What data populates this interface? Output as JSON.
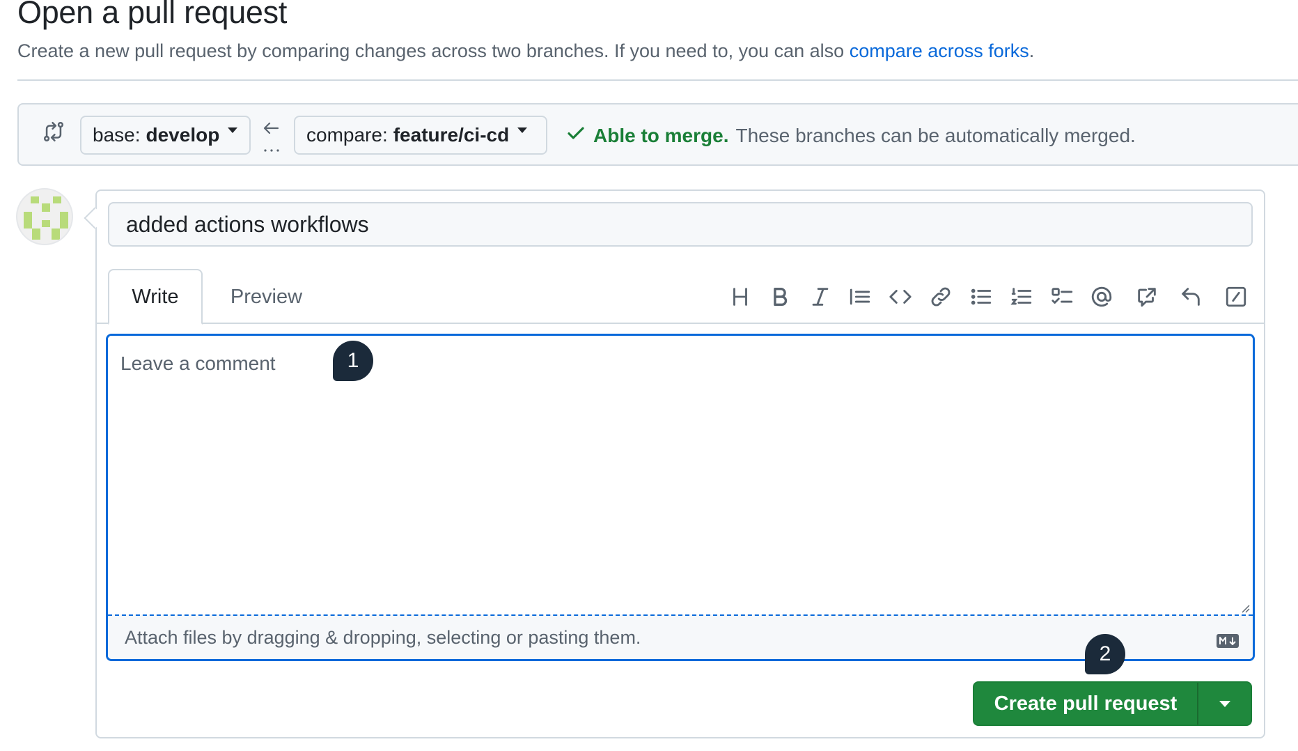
{
  "header": {
    "title": "Open a pull request",
    "subtitle_prefix": "Create a new pull request by comparing changes across two branches. If you need to, you can also ",
    "subtitle_link": "compare across forks",
    "subtitle_suffix": "."
  },
  "range": {
    "base_prefix": "base:",
    "base_branch": "develop",
    "compare_prefix": "compare:",
    "compare_branch": "feature/ci-cd",
    "merge_ok": "Able to merge.",
    "merge_message": "These branches can be automatically merged."
  },
  "composer": {
    "title_value": "added actions workflows",
    "tabs": [
      {
        "label": "Write",
        "active": true
      },
      {
        "label": "Preview",
        "active": false
      }
    ],
    "toolbar_icons": [
      "heading-icon",
      "bold-icon",
      "italic-icon",
      "quote-icon",
      "code-icon",
      "link-icon",
      "unordered-list-icon",
      "ordered-list-icon",
      "task-list-icon",
      "mention-icon",
      "cross-reference-icon",
      "saved-replies-icon",
      "slash-commands-icon"
    ],
    "comment_placeholder": "Leave a comment",
    "attach_text": "Attach files by dragging & dropping, selecting or pasting them.",
    "submit_label": "Create pull request"
  },
  "badges": {
    "one": "1",
    "two": "2"
  },
  "colors": {
    "accent": "#0969da",
    "success": "#1a7f37",
    "button": "#1f883d",
    "badge": "#1b2a3a"
  }
}
